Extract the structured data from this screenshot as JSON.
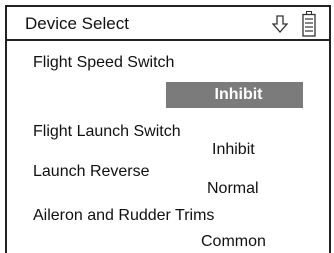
{
  "header": {
    "title": "Device Select",
    "icons": [
      "down-arrow-icon",
      "battery-icon"
    ]
  },
  "items": [
    {
      "label": "Flight Speed Switch",
      "value": "Inhibit",
      "selected": true
    },
    {
      "label": "Flight Launch Switch",
      "value": "Inhibit",
      "selected": false
    },
    {
      "label": "Launch Reverse",
      "value": "Normal",
      "selected": false
    },
    {
      "label": "Aileron and Rudder Trims",
      "value": "Common",
      "selected": false
    }
  ],
  "colors": {
    "selection_background": "#7b7b7b",
    "selection_text": "#ffffff",
    "border": "#222222"
  }
}
